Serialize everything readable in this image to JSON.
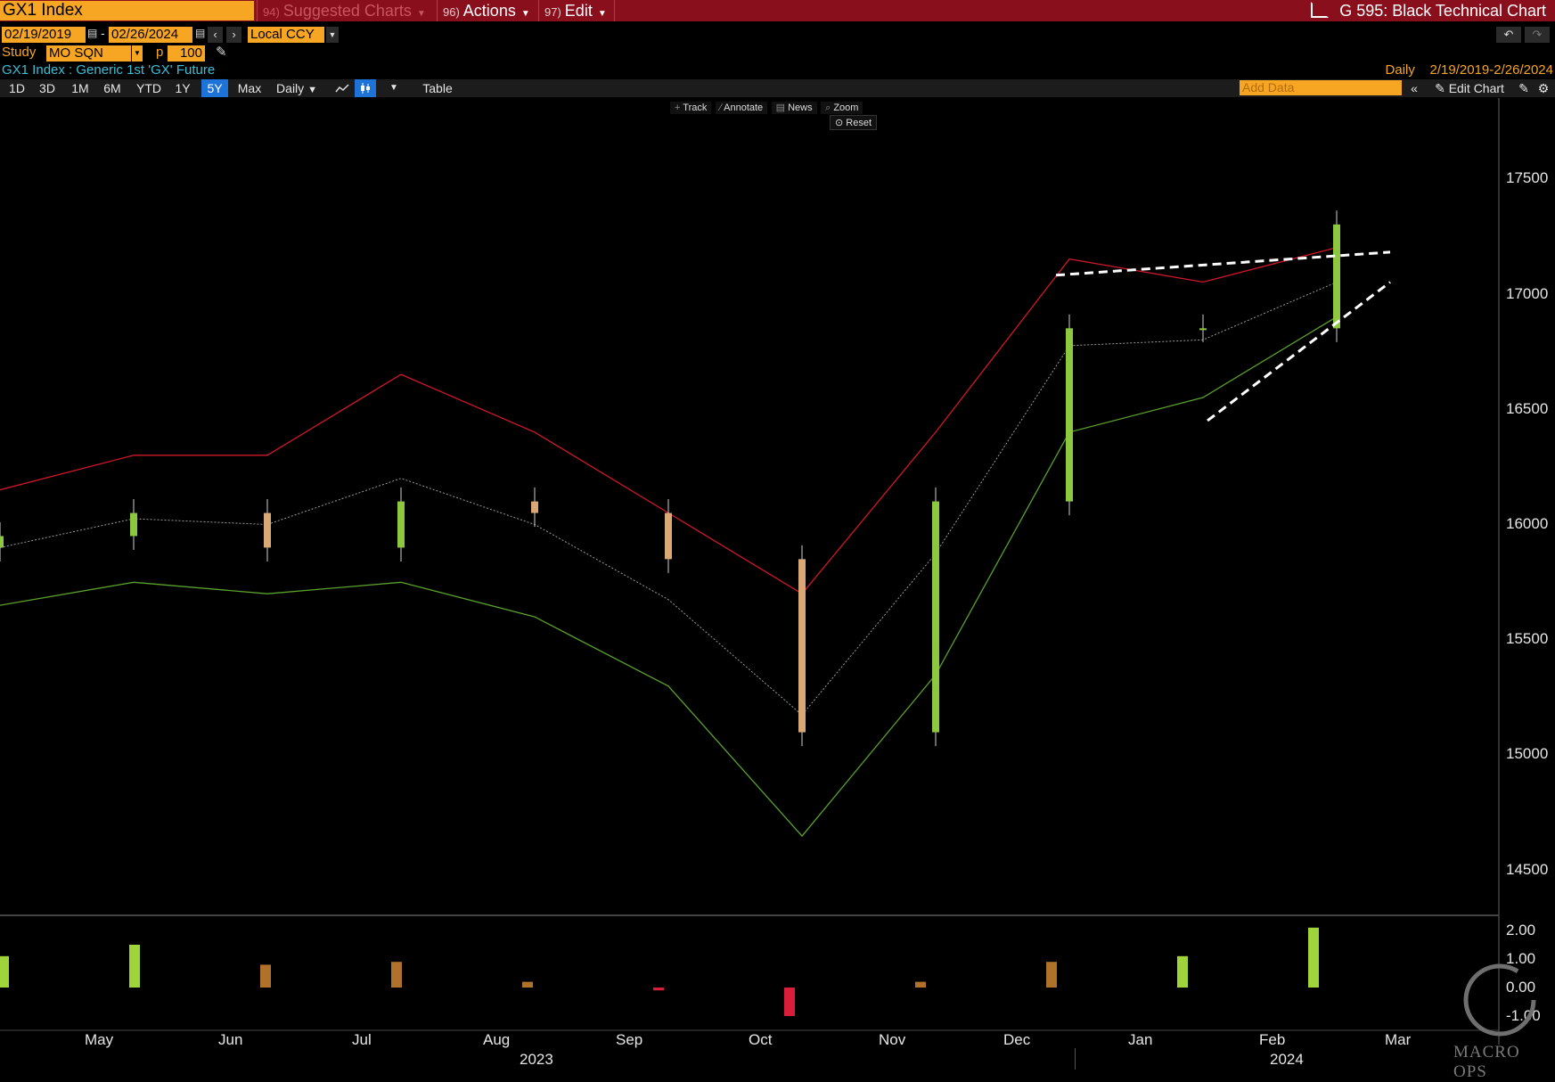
{
  "topbar": {
    "ticker": "GX1 Index",
    "menus": [
      {
        "num": "94)",
        "label": "Suggested Charts",
        "dim": true
      },
      {
        "num": "96)",
        "label": "Actions",
        "dim": false
      },
      {
        "num": "97)",
        "label": "Edit",
        "dim": false
      }
    ],
    "title": "G 595: Black Technical Chart"
  },
  "daterow": {
    "start": "02/19/2019",
    "end": "02/26/2024",
    "separator": "-",
    "currency": "Local CCY"
  },
  "studyrow": {
    "study_label": "Study",
    "study_value": "MO SQN",
    "p_label": "p",
    "p_value": "100"
  },
  "legend": {
    "security": "GX1 Index : Generic 1st 'GX' Future",
    "frequency": "Daily",
    "range": "2/19/2019-2/26/2024"
  },
  "toolbar": {
    "periods": [
      "1D",
      "3D",
      "1M",
      "6M",
      "YTD",
      "1Y",
      "5Y",
      "Max"
    ],
    "active_period": "5Y",
    "frequency": "Daily",
    "table_label": "Table",
    "add_data_placeholder": "Add Data",
    "edit_chart_label": "Edit Chart"
  },
  "chart_tools": {
    "track": "Track",
    "annotate": "Annotate",
    "news": "News",
    "zoom": "Zoom",
    "reset": "Reset"
  },
  "colors": {
    "up_candle": "#8dc63f",
    "down_candle": "#d9a875",
    "upper_band": "#d0182a",
    "lower_band": "#5aa02c",
    "mid_line": "#9a9a9a",
    "trendline": "#ffffff",
    "topbar": "#8a0f1d",
    "accent": "#f6a623"
  },
  "chart_data": [
    {
      "type": "candlestick",
      "series_name": "GX1 Index",
      "ylim": [
        14300,
        17800
      ],
      "yticks": [
        14500,
        15000,
        15500,
        16000,
        16500,
        17000,
        17500
      ],
      "xticks": [
        "May",
        "Jun",
        "Jul",
        "Aug",
        "Sep",
        "Oct",
        "Nov",
        "Dec",
        "Jan",
        "Feb",
        "Mar"
      ],
      "years": [
        "2023",
        "2024"
      ],
      "x": [
        "2023-04",
        "2023-05",
        "2023-06",
        "2023-07",
        "2023-08",
        "2023-09",
        "2023-10",
        "2023-11",
        "2023-12",
        "2024-01",
        "2024-02"
      ],
      "close": [
        15950,
        16050,
        15900,
        16100,
        16050,
        15850,
        15100,
        16100,
        16850,
        16850,
        17300
      ],
      "upper_band": [
        16150,
        16300,
        16300,
        16650,
        16400,
        16050,
        15700,
        16400,
        17150,
        17050,
        17200
      ],
      "lower_band": [
        15650,
        15750,
        15700,
        15750,
        15600,
        15300,
        14650,
        15350,
        16400,
        16550,
        16900
      ],
      "trendlines": [
        {
          "from": [
            "2023-11-28",
            17080
          ],
          "to": [
            "2024-02-13",
            17180
          ]
        },
        {
          "from": [
            "2024-01-02",
            16450
          ],
          "to": [
            "2024-02-13",
            17050
          ]
        }
      ]
    },
    {
      "type": "bar",
      "series_name": "MO SQN",
      "ylim": [
        -1.5,
        2.3
      ],
      "yticks": [
        2.0,
        1.0,
        0.0,
        -1.0
      ],
      "ytick_labels": [
        "2.00",
        "1.00",
        "0.00",
        "-1.00"
      ],
      "x": [
        "2023-04",
        "2023-05",
        "2023-06",
        "2023-07",
        "2023-08",
        "2023-09",
        "2023-10",
        "2023-11",
        "2023-12",
        "2024-01",
        "2024-02"
      ],
      "values": [
        1.1,
        1.5,
        0.8,
        0.9,
        0.2,
        -0.1,
        -1.0,
        0.2,
        0.9,
        1.1,
        2.1
      ]
    }
  ],
  "watermark": "MACRO OPS"
}
